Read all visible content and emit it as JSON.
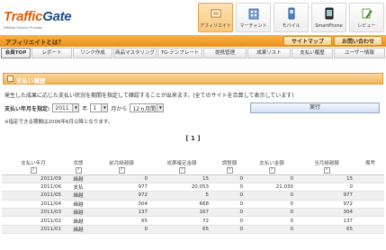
{
  "header": {
    "logo_part1": "Traffic",
    "logo_part2": "Gate",
    "logo_sub": "Affiliate Service Provider",
    "nav": [
      {
        "label": "アフィリエイト",
        "icon": "affiliate-icon",
        "active": true
      },
      {
        "label": "マーチャント",
        "icon": "building-icon",
        "active": false
      },
      {
        "label": "モバイル",
        "icon": "mobile-icon",
        "active": false
      },
      {
        "label": "SmartPhone",
        "icon": "smartphone-icon",
        "active": false
      },
      {
        "label": "レビュー",
        "icon": "review-icon",
        "active": false
      }
    ]
  },
  "orange_bar": {
    "left_label": "アフィリエイトとは？",
    "sitemap_label": "サイトマップ",
    "contact_label": "お問い合わせ"
  },
  "menu": [
    "会員TOP",
    "レポート",
    "リンク作成",
    "商品マスタリング",
    "TG-テンプレート",
    "提携管理",
    "成果リスト",
    "支払い履歴",
    "ユーザー情報"
  ],
  "page": {
    "heading": "支払い履歴",
    "intro": "発生した成果に応じた支払い状況を期間を指定して確認することが出来ます。(全てのサイトを合算して表示しています)",
    "filter_label": "支払い年月を指定:",
    "year": "2011",
    "year_unit": "年",
    "month": "1",
    "month_unit": "月から",
    "period": "12ヵ月間",
    "exec_label": "実行",
    "note": "※指定できる期間は2006年6月以降となります。",
    "pager": "[ 1 ]"
  },
  "table": {
    "headers": [
      "支払い年月",
      "状態",
      "前月繰越額",
      "成果確定金額",
      "調整額",
      "支払い金額",
      "当月繰越額",
      "備考"
    ],
    "rows": [
      [
        "2011/09",
        "繰越",
        "0",
        "15",
        "0",
        "0",
        "15",
        ""
      ],
      [
        "2011/06",
        "支払",
        "977",
        "20,053",
        "0",
        "21,030",
        "0",
        ""
      ],
      [
        "2011/05",
        "繰越",
        "972",
        "5",
        "0",
        "0",
        "977",
        ""
      ],
      [
        "2011/04",
        "繰越",
        "304",
        "668",
        "0",
        "0",
        "972",
        ""
      ],
      [
        "2011/03",
        "繰越",
        "137",
        "167",
        "0",
        "0",
        "304",
        ""
      ],
      [
        "2011/02",
        "繰越",
        "65",
        "72",
        "0",
        "0",
        "137",
        ""
      ],
      [
        "2011/01",
        "繰越",
        "0",
        "65",
        "0",
        "0",
        "65",
        ""
      ]
    ]
  },
  "colors": {
    "accent_orange": "#ec8d16",
    "logo_orange": "#e35d0c",
    "logo_blue": "#1a4f8b"
  }
}
